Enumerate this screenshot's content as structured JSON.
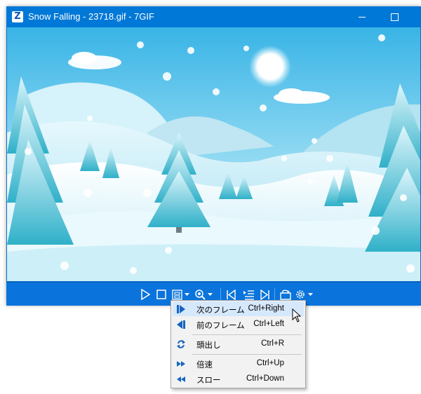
{
  "window": {
    "title": "Snow Falling - 23718.gif - 7GIF",
    "app_icon_glyph": "Z"
  },
  "toolbar": {
    "buttons": [
      "play-icon",
      "stop-icon",
      "frame-save-icon",
      "dropdown-arrow-icon",
      "zoom-icon",
      "dropdown-arrow-icon",
      "first-frame-icon",
      "frame-list-icon",
      "last-frame-icon",
      "open-folder-icon",
      "settings-icon",
      "dropdown-arrow-icon"
    ]
  },
  "menu": {
    "items": [
      {
        "label": "次のフレーム",
        "shortcut": "Ctrl+Right",
        "icon": "next-frame-icon"
      },
      {
        "label": "前のフレーム",
        "shortcut": "Ctrl+Left",
        "icon": "previous-frame-icon"
      },
      {
        "label": "頭出し",
        "shortcut": "Ctrl+R",
        "icon": "rewind-icon"
      },
      {
        "label": "倍速",
        "shortcut": "Ctrl+Up",
        "icon": "fast-icon"
      },
      {
        "label": "スロー",
        "shortcut": "Ctrl+Down",
        "icon": "slow-icon"
      }
    ]
  },
  "colors": {
    "titlebar": "#0078d7",
    "toolbar": "#0a74dc",
    "menu_background": "#f2f2f2",
    "menu_highlight": "#d6e8fb",
    "icon_blue": "#1565c0"
  }
}
